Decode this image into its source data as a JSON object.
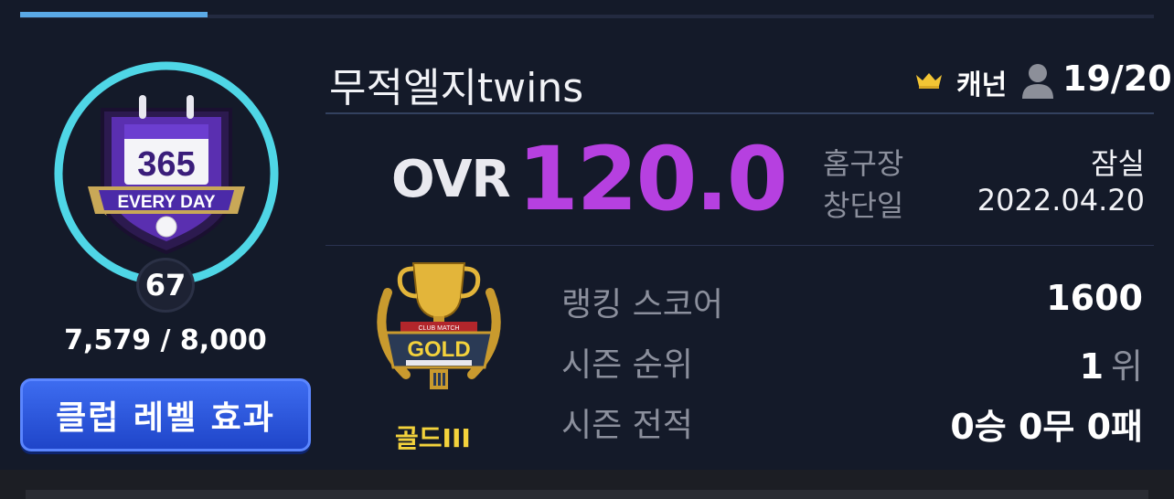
{
  "tabs": {
    "active_index": 0
  },
  "club": {
    "emblem_top": "365",
    "emblem_banner": "EVERY DAY",
    "level": "67",
    "exp_text": "7,579 / 8,000",
    "exp_progress": 0.947,
    "effect_button": "클럽 레벨 효과"
  },
  "header": {
    "team_name": "무적엘지twins",
    "captain_label": "캐넌",
    "roster": "19/20"
  },
  "ovr": {
    "label": "OVR",
    "value": "120.0"
  },
  "info": [
    {
      "label": "홈구장",
      "value": "잠실"
    },
    {
      "label": "창단일",
      "value": "2022.04.20"
    }
  ],
  "rank": {
    "tier_emblem_text": "GOLD",
    "tier_emblem_small": "CLUB MATCH",
    "tier_name": "골드III",
    "stats": [
      {
        "label": "랭킹 스코어",
        "value": "1600",
        "unit": ""
      },
      {
        "label": "시즌 순위",
        "value": "1",
        "unit": "위"
      },
      {
        "label": "시즌 전적",
        "value": "0승 0무 0패",
        "unit": ""
      }
    ]
  },
  "colors": {
    "background": "#141a29",
    "accent_blue": "#5aa9e6",
    "ovr_purple": "#b640e0",
    "ring_cyan": "#4fd6e6",
    "tier_gold": "#f3d23c",
    "button_blue": "#2a58e0"
  },
  "icons": [
    "crown-icon",
    "person-icon"
  ]
}
